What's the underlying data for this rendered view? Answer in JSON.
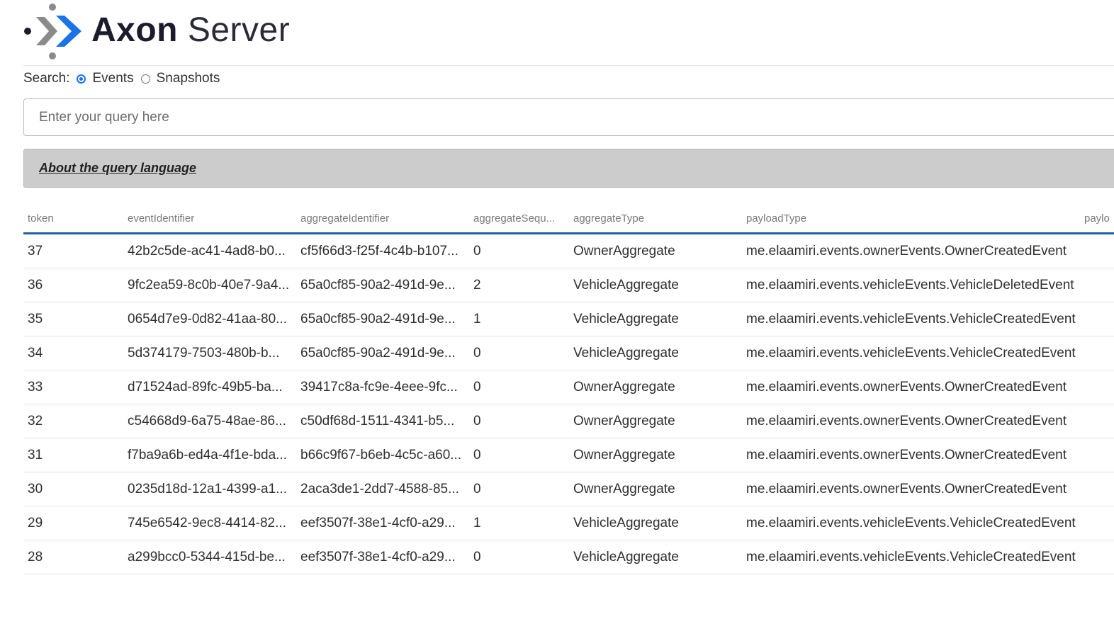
{
  "brand": {
    "name_bold": "Axon",
    "name_light": "Server",
    "logo_icon": "axon-logo-icon",
    "colors": {
      "accent": "#1a73e8",
      "dark_chevron": "#0d5bbf",
      "grey_chevron": "#8a8a8a"
    }
  },
  "search": {
    "label": "Search:",
    "options": [
      {
        "label": "Events",
        "selected": true
      },
      {
        "label": "Snapshots",
        "selected": false
      }
    ],
    "placeholder": "Enter your query here",
    "value": ""
  },
  "about": {
    "link_label": "About the query language"
  },
  "table": {
    "columns": [
      "token",
      "eventIdentifier",
      "aggregateIdentifier",
      "aggregateSequ...",
      "aggregateType",
      "payloadType",
      "paylo"
    ],
    "rows": [
      [
        "37",
        "42b2c5de-ac41-4ad8-b0...",
        "cf5f66d3-f25f-4c4b-b107...",
        "0",
        "OwnerAggregate",
        "me.elaamiri.events.ownerEvents.OwnerCreatedEvent",
        ""
      ],
      [
        "36",
        "9fc2ea59-8c0b-40e7-9a4...",
        "65a0cf85-90a2-491d-9e...",
        "2",
        "VehicleAggregate",
        "me.elaamiri.events.vehicleEvents.VehicleDeletedEvent",
        ""
      ],
      [
        "35",
        "0654d7e9-0d82-41aa-80...",
        "65a0cf85-90a2-491d-9e...",
        "1",
        "VehicleAggregate",
        "me.elaamiri.events.vehicleEvents.VehicleCreatedEvent",
        ""
      ],
      [
        "34",
        "5d374179-7503-480b-b...",
        "65a0cf85-90a2-491d-9e...",
        "0",
        "VehicleAggregate",
        "me.elaamiri.events.vehicleEvents.VehicleCreatedEvent",
        ""
      ],
      [
        "33",
        "d71524ad-89fc-49b5-ba...",
        "39417c8a-fc9e-4eee-9fc...",
        "0",
        "OwnerAggregate",
        "me.elaamiri.events.ownerEvents.OwnerCreatedEvent",
        ""
      ],
      [
        "32",
        "c54668d9-6a75-48ae-86...",
        "c50df68d-1511-4341-b5...",
        "0",
        "OwnerAggregate",
        "me.elaamiri.events.ownerEvents.OwnerCreatedEvent",
        ""
      ],
      [
        "31",
        "f7ba9a6b-ed4a-4f1e-bda...",
        "b66c9f67-b6eb-4c5c-a60...",
        "0",
        "OwnerAggregate",
        "me.elaamiri.events.ownerEvents.OwnerCreatedEvent",
        ""
      ],
      [
        "30",
        "0235d18d-12a1-4399-a1...",
        "2aca3de1-2dd7-4588-85...",
        "0",
        "OwnerAggregate",
        "me.elaamiri.events.ownerEvents.OwnerCreatedEvent",
        ""
      ],
      [
        "29",
        "745e6542-9ec8-4414-82...",
        "eef3507f-38e1-4cf0-a29...",
        "1",
        "VehicleAggregate",
        "me.elaamiri.events.vehicleEvents.VehicleCreatedEvent",
        ""
      ],
      [
        "28",
        "a299bcc0-5344-415d-be...",
        "eef3507f-38e1-4cf0-a29...",
        "0",
        "VehicleAggregate",
        "me.elaamiri.events.vehicleEvents.VehicleCreatedEvent",
        ""
      ]
    ]
  }
}
